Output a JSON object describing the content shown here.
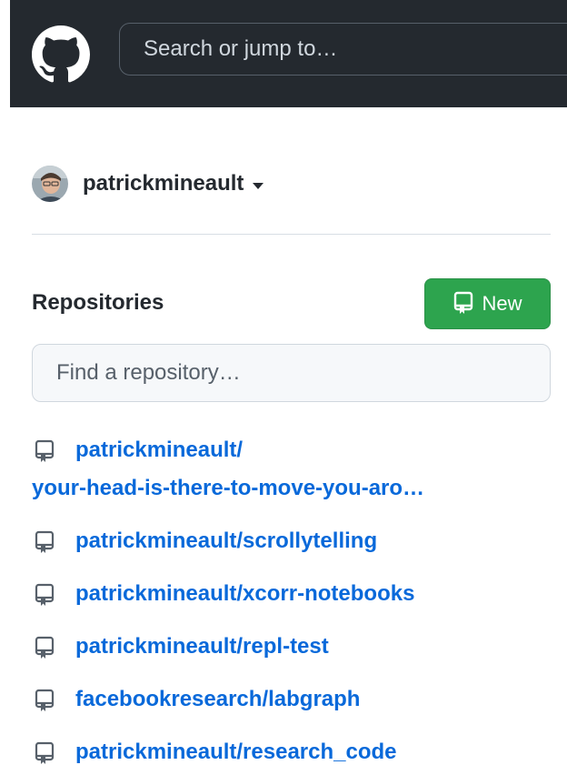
{
  "header": {
    "search_placeholder": "Search or jump to…",
    "logo_icon": "github-mark-icon",
    "background_color": "#24292f"
  },
  "user": {
    "username": "patrickmineault",
    "avatar_icon": "user-avatar",
    "dropdown_icon": "caret-down-icon"
  },
  "repositories": {
    "title": "Repositories",
    "new_button_label": "New",
    "new_button_icon": "repo-icon",
    "new_button_color": "#2da44e",
    "find_placeholder": "Find a repository…",
    "link_color": "#0969da",
    "items": [
      {
        "line1": "patrickmineault/",
        "line2": "your-head-is-there-to-move-you-aro…",
        "icon": "repo-icon"
      },
      {
        "label": "patrickmineault/scrollytelling",
        "icon": "repo-icon"
      },
      {
        "label": "patrickmineault/xcorr-notebooks",
        "icon": "repo-icon"
      },
      {
        "label": "patrickmineault/repl-test",
        "icon": "repo-icon"
      },
      {
        "label": "facebookresearch/labgraph",
        "icon": "repo-icon"
      },
      {
        "label": "patrickmineault/research_code",
        "icon": "repo-icon"
      }
    ]
  }
}
